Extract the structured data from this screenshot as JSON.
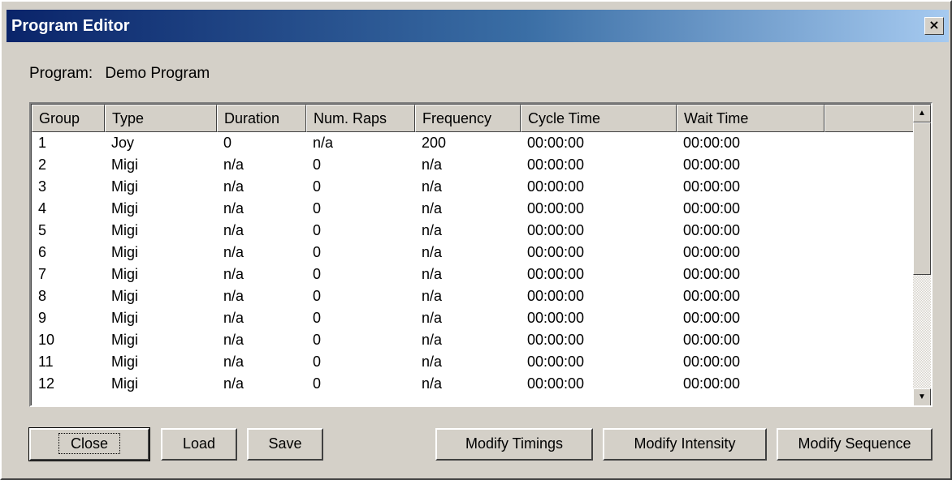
{
  "window": {
    "title": "Program Editor",
    "close_glyph": "×",
    "titlebar_colors": [
      "#0a246a",
      "#3a6ea5",
      "#a6caf0"
    ]
  },
  "program": {
    "label": "Program:",
    "name": "Demo Program"
  },
  "table": {
    "columns": [
      "Group",
      "Type",
      "Duration",
      "Num. Raps",
      "Frequency",
      "Cycle Time",
      "Wait Time",
      ""
    ],
    "rows": [
      [
        "1",
        "Joy",
        "0",
        "n/a",
        "200",
        "00:00:00",
        "00:00:00"
      ],
      [
        "2",
        "Migi",
        "n/a",
        "0",
        "n/a",
        "00:00:00",
        "00:00:00"
      ],
      [
        "3",
        "Migi",
        "n/a",
        "0",
        "n/a",
        "00:00:00",
        "00:00:00"
      ],
      [
        "4",
        "Migi",
        "n/a",
        "0",
        "n/a",
        "00:00:00",
        "00:00:00"
      ],
      [
        "5",
        "Migi",
        "n/a",
        "0",
        "n/a",
        "00:00:00",
        "00:00:00"
      ],
      [
        "6",
        "Migi",
        "n/a",
        "0",
        "n/a",
        "00:00:00",
        "00:00:00"
      ],
      [
        "7",
        "Migi",
        "n/a",
        "0",
        "n/a",
        "00:00:00",
        "00:00:00"
      ],
      [
        "8",
        "Migi",
        "n/a",
        "0",
        "n/a",
        "00:00:00",
        "00:00:00"
      ],
      [
        "9",
        "Migi",
        "n/a",
        "0",
        "n/a",
        "00:00:00",
        "00:00:00"
      ],
      [
        "10",
        "Migi",
        "n/a",
        "0",
        "n/a",
        "00:00:00",
        "00:00:00"
      ],
      [
        "11",
        "Migi",
        "n/a",
        "0",
        "n/a",
        "00:00:00",
        "00:00:00"
      ],
      [
        "12",
        "Migi",
        "n/a",
        "0",
        "n/a",
        "00:00:00",
        "00:00:00"
      ]
    ]
  },
  "scrollbar": {
    "up_glyph": "▲",
    "down_glyph": "▼"
  },
  "buttons": {
    "close": "Close",
    "load": "Load",
    "save": "Save",
    "modify_timings": "Modify Timings",
    "modify_intensity": "Modify Intensity",
    "modify_sequence": "Modify Sequence"
  }
}
